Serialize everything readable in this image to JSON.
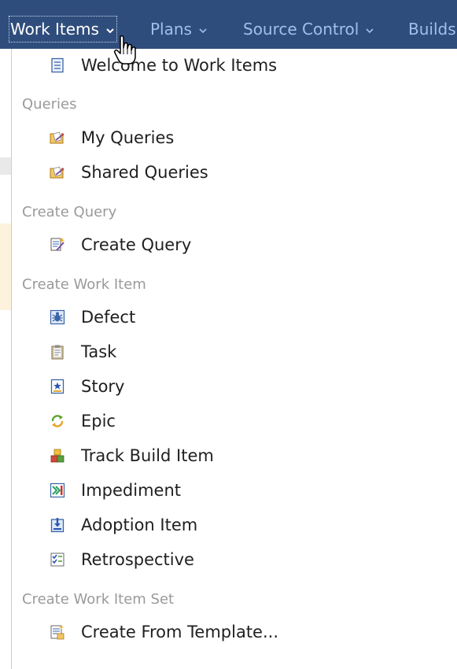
{
  "nav": {
    "items": [
      {
        "label": "Work Items",
        "active": true
      },
      {
        "label": "Plans"
      },
      {
        "label": "Source Control"
      },
      {
        "label": "Builds"
      }
    ]
  },
  "menu": {
    "welcome": {
      "label": "Welcome to Work Items",
      "icon": "list-icon"
    },
    "sections": [
      {
        "heading": "Queries",
        "items": [
          {
            "label": "My Queries",
            "icon": "query-folder-icon"
          },
          {
            "label": "Shared Queries",
            "icon": "query-folder-icon"
          }
        ]
      },
      {
        "heading": "Create Query",
        "items": [
          {
            "label": "Create Query",
            "icon": "create-query-icon"
          }
        ]
      },
      {
        "heading": "Create Work Item",
        "items": [
          {
            "label": "Defect",
            "icon": "bug-icon"
          },
          {
            "label": "Task",
            "icon": "clipboard-icon"
          },
          {
            "label": "Story",
            "icon": "story-icon"
          },
          {
            "label": "Epic",
            "icon": "cycle-icon"
          },
          {
            "label": "Track Build Item",
            "icon": "blocks-icon"
          },
          {
            "label": "Impediment",
            "icon": "impediment-icon"
          },
          {
            "label": "Adoption Item",
            "icon": "adoption-icon"
          },
          {
            "label": "Retrospective",
            "icon": "retrospective-icon"
          }
        ]
      },
      {
        "heading": "Create Work Item Set",
        "items": [
          {
            "label": "Create From Template...",
            "icon": "template-icon"
          }
        ]
      }
    ]
  },
  "colors": {
    "navbar": "#2f4d7c",
    "nav_text": "#9fc0ea",
    "nav_active_text": "#ffffff",
    "heading_text": "#9a9a9a",
    "item_text": "#1f1f1f"
  }
}
